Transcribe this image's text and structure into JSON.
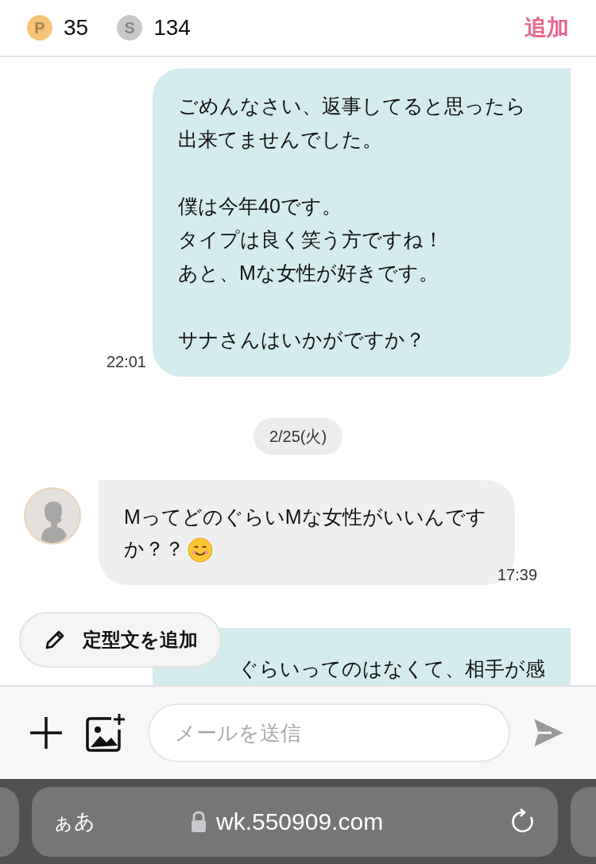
{
  "header": {
    "points": [
      {
        "letter": "P",
        "value": "35",
        "color": "#f5c477"
      },
      {
        "letter": "S",
        "value": "134",
        "color": "#c8c8c8"
      }
    ],
    "add_label": "追加"
  },
  "messages": [
    {
      "kind": "sent",
      "paragraphs": [
        [
          "ごめんなさい、返事してると思ったら出来てませんでした。"
        ],
        [
          "僕は今年40です。",
          "タイプは良く笑う方ですね！",
          "あと、Mな女性が好きです。"
        ],
        [
          "サナさんはいかがですか？"
        ]
      ],
      "time": "22:01"
    },
    {
      "kind": "date",
      "text": "2/25(火)"
    },
    {
      "kind": "received",
      "text": "MってどのぐらいMな女性がいいんですか？？",
      "time": "17:39",
      "emoji": true
    },
    {
      "kind": "sent_partial",
      "text": "ぐらいってのはなくて、相手が感"
    }
  ],
  "template_button": "定型文を追加",
  "composer": {
    "placeholder": "メールを送信"
  },
  "browser": {
    "text_size": "ぁあ",
    "url": "wk.550909.com"
  }
}
